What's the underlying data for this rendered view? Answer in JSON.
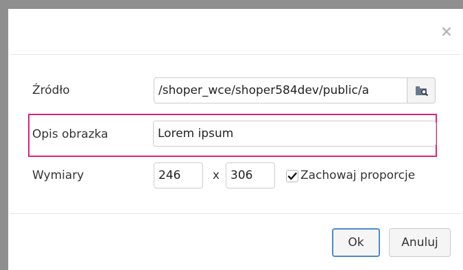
{
  "dialog": {
    "close_glyph": "×",
    "fields": {
      "source": {
        "label": "Źródło",
        "value": "/shoper_wce/shoper584dev/public/a",
        "browse_icon": "folder-search-icon"
      },
      "description": {
        "label": "Opis obrazka",
        "value": "Lorem ipsum"
      },
      "dimensions": {
        "label": "Wymiary",
        "width": "246",
        "separator": "x",
        "height": "306",
        "keep_ratio_label": "Zachowaj proporcje",
        "keep_ratio_checked": true
      }
    },
    "buttons": {
      "ok": "Ok",
      "cancel": "Anuluj"
    }
  },
  "colors": {
    "highlight": "#e01f79",
    "ok_border": "#4a8ac9",
    "backdrop": "#8f8f8f"
  }
}
